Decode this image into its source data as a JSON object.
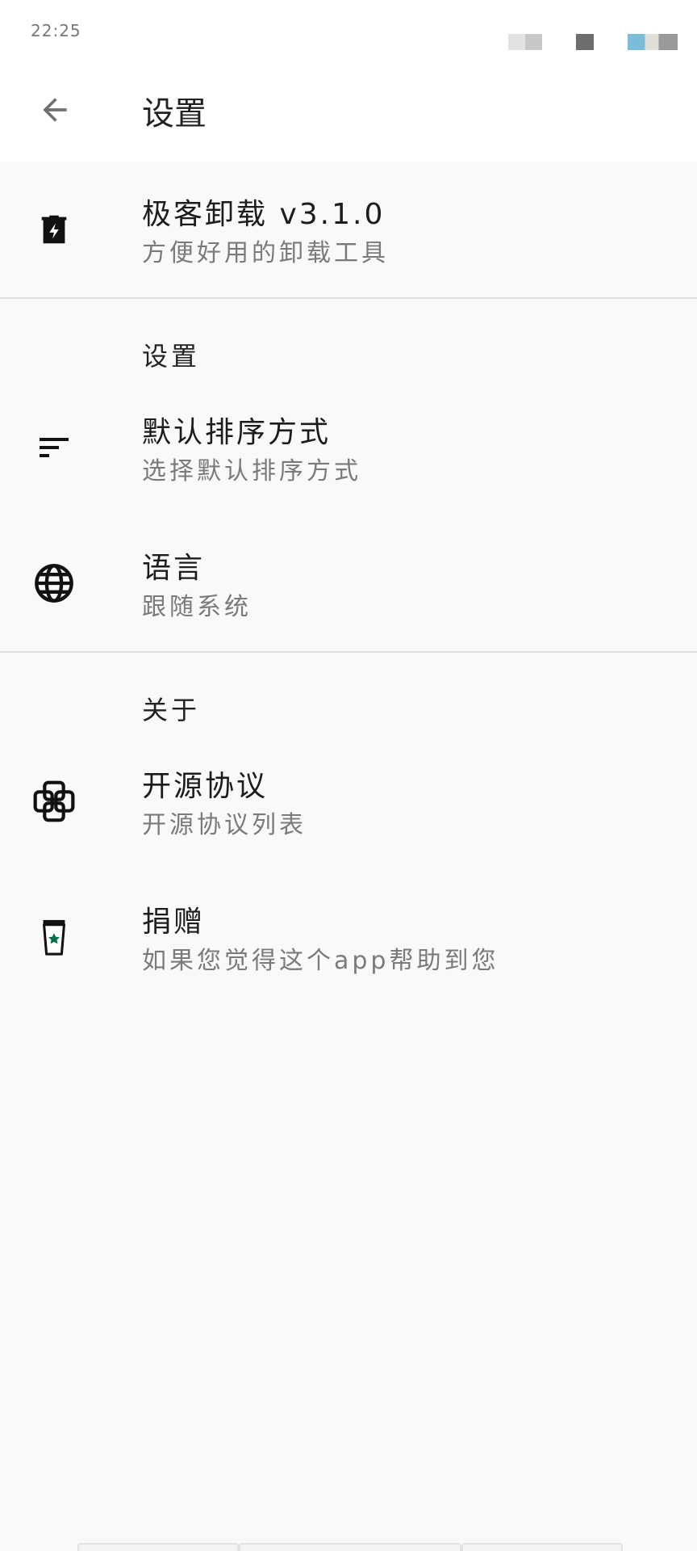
{
  "status_bar": {
    "time": "22:25",
    "colors": {
      "block_light": "#d8d8d8",
      "block_dark": "#6e6e6e",
      "battery_accent": "#7bbcd8"
    }
  },
  "app_bar": {
    "back_icon": "arrow-left-icon",
    "title": "设置"
  },
  "header_item": {
    "icon": "trash-bolt-icon",
    "title": "极客卸载 v3.1.0",
    "subtitle": "方便好用的卸载工具"
  },
  "sections": [
    {
      "header": "设置",
      "items": [
        {
          "icon": "sort-icon",
          "title": "默认排序方式",
          "subtitle": "选择默认排序方式"
        },
        {
          "icon": "globe-icon",
          "title": "语言",
          "subtitle": "跟随系统"
        }
      ]
    },
    {
      "header": "关于",
      "items": [
        {
          "icon": "open-source-icon",
          "title": "开源协议",
          "subtitle": "开源协议列表"
        },
        {
          "icon": "coffee-cup-icon",
          "title": "捐赠",
          "subtitle": "如果您觉得这个app帮助到您"
        }
      ]
    }
  ],
  "theme": {
    "accent_star": "#00704a",
    "background": "#f9f9f9"
  }
}
